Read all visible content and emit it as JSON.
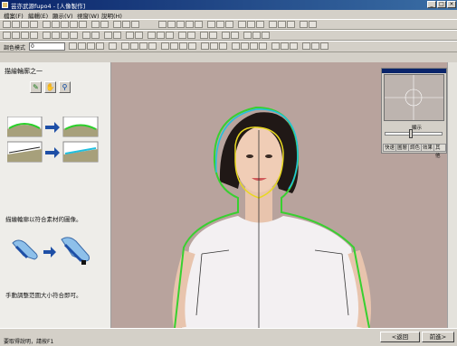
{
  "window": {
    "title": "芸亦武源fupo4 - [人像製作]"
  },
  "menu": [
    "檔案(F)",
    "編輯(E)",
    "顯示(V)",
    "視窗(W)",
    "說明(H)"
  ],
  "toolbar3": {
    "label": "調色模式",
    "combo_value": "0"
  },
  "left_panel": {
    "title": "描繪輪廓之一",
    "tools": [
      "pen-icon",
      "hand-icon",
      "magnify-icon"
    ],
    "text1": "描繪輪廓以符合素材的圖像。",
    "text2": "手動調整范圍大小符合即可。"
  },
  "nav_panel": {
    "zoom_label": "顯示",
    "tabs": [
      "快速",
      "圖層",
      "調色",
      "效果",
      "其他"
    ]
  },
  "buttons": {
    "back": "<返回",
    "next": "前進>"
  },
  "status": {
    "text": "要取得說明，請按F1"
  },
  "colors": {
    "accent": "#0a246a",
    "contour_green": "#38d030",
    "contour_yellow": "#e8d820",
    "contour_cyan": "#20c0e0"
  }
}
